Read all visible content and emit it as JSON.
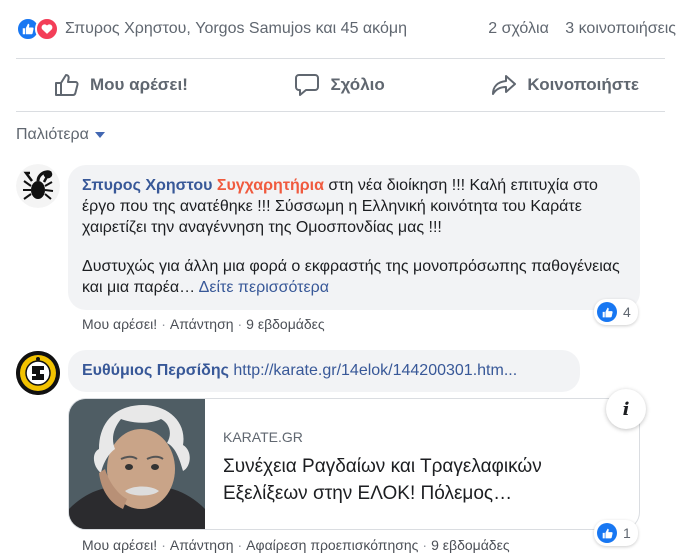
{
  "summary": {
    "names": "Σπυρος Χρηστου, Yorgos Samujos και 45 ακόμη",
    "comments": "2 σχόλια",
    "shares": "3 κοινοποιήσεις"
  },
  "actions": {
    "like": "Μου αρέσει!",
    "comment": "Σχόλιο",
    "share": "Κοινοποιήστε"
  },
  "filter": {
    "label": "Παλιότερα"
  },
  "comments": [
    {
      "author": "Σπυρος Χρηστου",
      "highlight": "Συγχαρητήρια",
      "text_1": " στη νέα διοίκηση !!! Καλή επιτυχία στο έργο που της ανατέθηκε !!! Σύσσωμη η Ελληνική κοινότητα του Καράτε χαιρετίζει την αναγέννηση της Ομοσπονδίας μας !!!",
      "text_2": "Δυστυχώς για άλλη μια φορά ο εκφραστής της μονοπρόσωπης παθογένειας και μια παρέα…",
      "see_more": "Δείτε περισσότερα",
      "like": "Μου αρέσει!",
      "reply": "Απάντηση",
      "time": "9 εβδομάδες",
      "reactions": "4"
    },
    {
      "author": "Ευθύμιος Περσίδης",
      "link": "http://karate.gr/14elok/144200301.htm...",
      "like": "Μου αρέσει!",
      "reply": "Απάντηση",
      "remove_preview": "Αφαίρεση προεπισκόπησης",
      "time": "9 εβδομάδες",
      "reactions": "1",
      "card": {
        "domain": "KARATE.GR",
        "title": "Συνέχεια Ραγδαίων και Τραγελαφικών Εξελίξεων στην ΕΛΟΚ! Πόλεμος…",
        "info": "i"
      }
    }
  ],
  "colors": {
    "link": "#385898",
    "highlight": "#f05a3e",
    "like_blue": "#1877f2",
    "love_red": "#f33e58",
    "bubble": "#f2f3f5"
  }
}
